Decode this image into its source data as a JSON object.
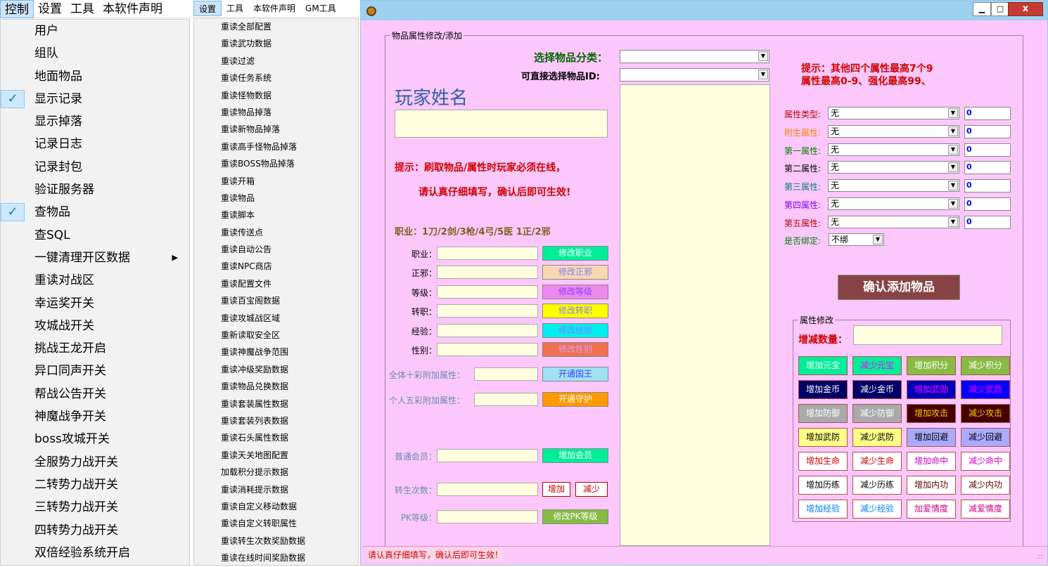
{
  "menu1": {
    "menubar": [
      "控制",
      "设置",
      "工具",
      "本软件声明"
    ],
    "items": [
      {
        "label": "用户",
        "checked": false
      },
      {
        "label": "组队",
        "checked": false
      },
      {
        "label": "地面物品",
        "checked": false
      },
      {
        "label": "显示记录",
        "checked": true
      },
      {
        "label": "显示掉落",
        "checked": false
      },
      {
        "label": "记录日志",
        "checked": false
      },
      {
        "label": "记录封包",
        "checked": false
      },
      {
        "label": "验证服务器",
        "checked": false
      },
      {
        "label": "查物品",
        "checked": true
      },
      {
        "label": "查SQL",
        "checked": false
      },
      {
        "label": "一键清理开区数据",
        "checked": false,
        "submenu": true
      },
      {
        "label": "重读对战区",
        "checked": false
      },
      {
        "label": "幸运奖开关",
        "checked": false
      },
      {
        "label": "攻城战开关",
        "checked": false
      },
      {
        "label": "挑战王龙开启",
        "checked": false
      },
      {
        "label": "异口同声开关",
        "checked": false
      },
      {
        "label": "帮战公告开关",
        "checked": false
      },
      {
        "label": "神魔战争开关",
        "checked": false
      },
      {
        "label": "boss攻城开关",
        "checked": false
      },
      {
        "label": "全服势力战开关",
        "checked": false
      },
      {
        "label": "二转势力战开关",
        "checked": false
      },
      {
        "label": "三转势力战开关",
        "checked": false
      },
      {
        "label": "四转势力战开关",
        "checked": false
      },
      {
        "label": "双倍经验系统开启",
        "checked": false
      }
    ],
    "check_glyph": "✓",
    "arrow_glyph": "▶"
  },
  "menu2": {
    "menubar": [
      "设置",
      "工具",
      "本软件声明",
      "GM工具"
    ],
    "items": [
      "重读全部配置",
      "重读武功数据",
      "重读过滤",
      "重读任务系统",
      "重读怪物数据",
      "重读物品掉落",
      "重读新物品掉落",
      "重读高手怪物品掉落",
      "重读BOSS物品掉落",
      "重读开箱",
      "重读物品",
      "重读脚本",
      "重读传送点",
      "重读自动公告",
      "重读NPC商店",
      "重读配置文件",
      "重读百宝阁数据",
      "重读攻城战区域",
      "重新读取安全区",
      "重读神魔战争范围",
      "重读冲级奖励数据",
      "重读物品兑换数据",
      "重读套装属性数据",
      "重读套装列表数据",
      "重读石头属性数据",
      "重读天关地图配置",
      "加载积分提示数据",
      "重读消耗提示数据",
      "重读自定义移动数据",
      "重读自定义转职属性",
      "重读转生次数奖励数据",
      "重读在线时间奖励数据"
    ]
  },
  "window": {
    "controls": {
      "min": "▁",
      "max": "□",
      "close": "x"
    },
    "group_item": "物品属性修改/添加",
    "select_category_label": "选择物品分类：",
    "select_id_label": "可直接选择物品ID:",
    "player_name_label": "玩家姓名",
    "tip1": "提示：刷取物品/属性时玩家必须在线，",
    "tip2": "请认真仔细填写，确认后即可生效!",
    "job_tip": "职业：1刀/2剑/3枪/4弓/5医   1正/2邪",
    "top_tip1": "提示：其他四个属性最高7个9",
    "top_tip2": "属性最高0-9、强化最高99、",
    "fields": [
      {
        "label": "职业：",
        "button": "修改职业",
        "bg": "#00ee99",
        "color": "#fff"
      },
      {
        "label": "正邪：",
        "button": "修改正邪",
        "bg": "#f6d8b0",
        "color": "#8080ff"
      },
      {
        "label": "等级：",
        "button": "修改等级",
        "bg": "#ee88ee",
        "color": "#8844ff"
      },
      {
        "label": "转职：",
        "button": "修改转职",
        "bg": "#ffff00",
        "color": "#8080ff"
      },
      {
        "label": "经验：",
        "button": "修改经验",
        "bg": "#00eeee",
        "color": "#8080ff"
      },
      {
        "label": "性别：",
        "button": "修改性别",
        "bg": "#f07050",
        "color": "#d0a0ff"
      }
    ],
    "extra_fields": [
      {
        "label": "全体十彩附加属性：",
        "button": "开通国王",
        "bg": "#a0e0f0",
        "color": "#4040ff"
      },
      {
        "label": "个人五彩附加属性：",
        "button": "开通守护",
        "bg": "#ff9900",
        "color": "#fff"
      }
    ],
    "vip_label": "普通会员：",
    "vip_button": "增加会员",
    "rebirth_label": "转生次数：",
    "rebirth_add": "增加",
    "rebirth_sub": "减少",
    "pk_label": "PK等级：",
    "pk_button": "修改PK等级",
    "attrs": [
      {
        "label": "属性类型:",
        "color": "#c00000",
        "value": "无",
        "num": "0"
      },
      {
        "label": "附生属性:",
        "color": "#ff8000",
        "value": "无",
        "num": "0"
      },
      {
        "label": "第一属性:",
        "color": "#008000",
        "value": "无",
        "num": "0"
      },
      {
        "label": "第二属性:",
        "color": "#000000",
        "value": "无",
        "num": "0"
      },
      {
        "label": "第三属性:",
        "color": "#008080",
        "value": "无",
        "num": "0"
      },
      {
        "label": "第四属性:",
        "color": "#8000ff",
        "value": "无",
        "num": "0"
      },
      {
        "label": "第五属性:",
        "color": "#c00000",
        "value": "无",
        "num": "0"
      }
    ],
    "bind_label": "是否绑定:",
    "bind_value": "不绑",
    "confirm_button": "确认添加物品",
    "attr_group": "属性修改",
    "increment_label": "增减数量：",
    "grid_buttons": [
      {
        "label": "增加元宝",
        "bg": "#00ee99",
        "color": "#fff"
      },
      {
        "label": "减少元宝",
        "bg": "#00ee99",
        "color": "#ff00ff"
      },
      {
        "label": "增加积分",
        "bg": "#88bb44",
        "color": "#fff"
      },
      {
        "label": "减少积分",
        "bg": "#88bb44",
        "color": "#fff"
      },
      {
        "label": "增加金币",
        "bg": "#000066",
        "color": "#fff"
      },
      {
        "label": "减少金币",
        "bg": "#000066",
        "color": "#fff"
      },
      {
        "label": "增加武勋",
        "bg": "#0000bb",
        "color": "#ff00ff"
      },
      {
        "label": "减少武勋",
        "bg": "#0000ff",
        "color": "#ff00ff"
      },
      {
        "label": "增加防御",
        "bg": "#aaaaaa",
        "color": "#fff"
      },
      {
        "label": "减少防御",
        "bg": "#aaaaaa",
        "color": "#fff"
      },
      {
        "label": "增加攻击",
        "bg": "#440000",
        "color": "#ffcc00"
      },
      {
        "label": "减少攻击",
        "bg": "#440000",
        "color": "#ffcc00"
      },
      {
        "label": "增加武防",
        "bg": "#ffff88",
        "color": "#000"
      },
      {
        "label": "减少武防",
        "bg": "#ffff88",
        "color": "#000"
      },
      {
        "label": "增加回避",
        "bg": "#aaaaff",
        "color": "#000"
      },
      {
        "label": "减少回避",
        "bg": "#aaaaff",
        "color": "#000"
      },
      {
        "label": "增加生命",
        "bg": "#ffffff",
        "color": "#cc0000"
      },
      {
        "label": "减少生命",
        "bg": "#ffffff",
        "color": "#cc0000"
      },
      {
        "label": "增加命中",
        "bg": "#ffffff",
        "color": "#cc00cc"
      },
      {
        "label": "减少命中",
        "bg": "#ffffff",
        "color": "#cc00cc"
      },
      {
        "label": "增加历练",
        "bg": "#ffffff",
        "color": "#000"
      },
      {
        "label": "减少历练",
        "bg": "#ffffff",
        "color": "#000"
      },
      {
        "label": "增加内功",
        "bg": "#ffffff",
        "color": "#660000"
      },
      {
        "label": "减少内功",
        "bg": "#ffffff",
        "color": "#660000"
      },
      {
        "label": "增加经验",
        "bg": "#ffffff",
        "color": "#0080ff"
      },
      {
        "label": "减少经验",
        "bg": "#ffffff",
        "color": "#0080ff"
      },
      {
        "label": "加爱情度",
        "bg": "#ffffff",
        "color": "#cc0088"
      },
      {
        "label": "减爱情度",
        "bg": "#ffffff",
        "color": "#cc0088"
      }
    ],
    "status_text": "请认真仔细填写，确认后即可生效！",
    "grip": ".::"
  }
}
